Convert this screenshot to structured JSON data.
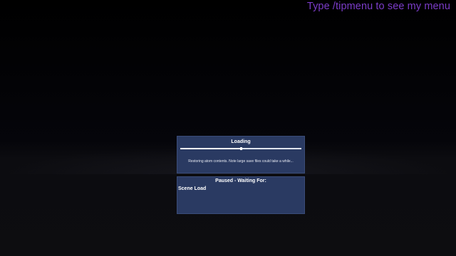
{
  "hud": {
    "tip": "Type /tipmenu to see my menu",
    "tip_color": "#7b3cc8"
  },
  "loading_panel": {
    "title": "Loading",
    "progress": 0.5,
    "message": "Restoring atom contents. Note large save files could take a while..."
  },
  "waiting_panel": {
    "title": "Paused - Waiting For:",
    "items": [
      "Scene Load"
    ]
  },
  "colors": {
    "panel_bg": "#2a3a62",
    "panel_border": "#3a4c78",
    "background": "#000000"
  }
}
